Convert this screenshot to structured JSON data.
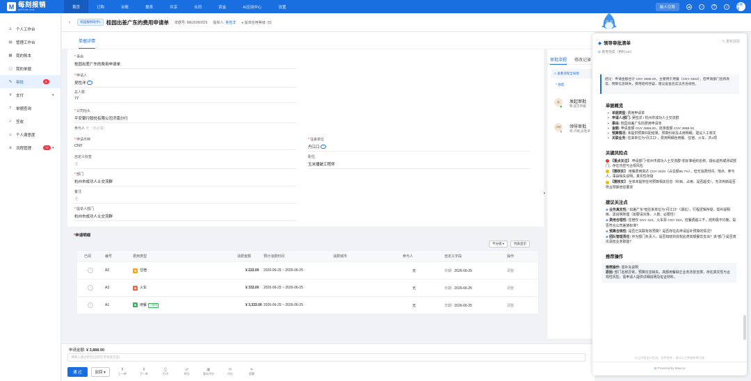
{
  "brand": {
    "logo_text": "每刻报销",
    "logo_sub": "MAYCUR.COM",
    "logo_glyph": "M"
  },
  "topnav": [
    "首页",
    "订购",
    "台账",
    "报表",
    "共享",
    "合同",
    "资金",
    "AI应用中心",
    "设置"
  ],
  "topbar": {
    "guide": "新人引导",
    "avatar_text": "吴熙洋",
    "icons": [
      "cloud-icon",
      "download-icon",
      "question-icon",
      "bell-icon"
    ]
  },
  "sidebar": [
    {
      "label": "个人工作台",
      "icon": "person-icon"
    },
    {
      "label": "管理工作台",
      "icon": "dashboard-icon"
    },
    {
      "label": "我的账本",
      "icon": "ledger-icon"
    },
    {
      "label": "我的单据",
      "icon": "document-icon"
    },
    {
      "label": "审批",
      "icon": "pen-icon",
      "badge": "2",
      "active": true
    },
    {
      "label": "支付",
      "icon": "pay-icon",
      "arrow": "▾"
    },
    {
      "label": "单据查询",
      "icon": "search-icon"
    },
    {
      "label": "签收",
      "icon": "sign-icon"
    },
    {
      "label": "个人满意度",
      "icon": "smile-icon"
    },
    {
      "label": "流程管理",
      "icon": "flow-icon",
      "badge": "77",
      "arrow": "▾"
    }
  ],
  "header": {
    "tag": "校园报财助手1",
    "title": "桂园出差广东的费用申请单",
    "doc_no_label": "单据号:",
    "doc_no": "MK26060025",
    "submitter_label": "提单人:",
    "submitter": "吴性洋",
    "credit_label": "提单信用等级:",
    "credit": "(0)"
  },
  "tab": "单据详情",
  "form": {
    "subject": {
      "label": "事由",
      "value": "桂园出差广东的费用申请单"
    },
    "applicant": {
      "label": "申请人",
      "value": "吴性洋"
    },
    "people": {
      "label": "总人数",
      "value": "77"
    },
    "company": {
      "label": "公司抬头",
      "value": "平安银行股份有限公司济南分行"
    },
    "participants": {
      "label": "参与人",
      "value": "无（非必填）"
    },
    "currency": {
      "label": "申请币种",
      "value": "CNY"
    },
    "partner": {
      "label": "往来单位",
      "value": "丹江口"
    },
    "custom_tag": {
      "label": "自定义标签",
      "value": "无"
    },
    "position": {
      "label": "职位",
      "value": "玉米播破工程师"
    },
    "dept": {
      "label": "部门",
      "value": "杭州市成功人士交流群"
    },
    "remark": {
      "label": "备注",
      "value": "无"
    },
    "owner_dept": {
      "label": "提单人部门",
      "value": "杭州市成功人士交流群"
    }
  },
  "detail": {
    "title": "申请明细",
    "filter": "不分组",
    "setting": "列表显示",
    "columns": [
      "已阅",
      "编号",
      "费用类型",
      "消费金额",
      "预计消费时间",
      "消费城市",
      "参与人",
      "自定义字段",
      "操作"
    ],
    "rows": [
      {
        "no": "A2",
        "type": "住宿",
        "type_color": "#f6a623",
        "amount": "¥ 222.00",
        "time": "2026-06-25 ~ 2026-06-25",
        "city": "",
        "people": "无",
        "custom_label": "日期:",
        "custom": "2026-06-25",
        "op": "调整"
      },
      {
        "no": "A3",
        "type": "火车",
        "type_color": "#f06a3a",
        "amount": "¥ 333.00",
        "time": "2026-06-25 ~ 2026-06-25",
        "city": "",
        "people": "无",
        "custom_label": "日期:",
        "custom": "2026-06-25",
        "op": "调整"
      },
      {
        "no": "A1",
        "type": "用餐",
        "tag": "已推荐",
        "type_color": "#35b55b",
        "amount": "¥ 3,333.00",
        "time": "2026-06-25 ~ 2026-06-25",
        "city": "",
        "people": "无",
        "custom_label": "日期:",
        "custom": "2026-06-25",
        "op": "调整"
      }
    ]
  },
  "footer": {
    "amount_label": "申请金额:",
    "amount": "¥ 3,888.00",
    "comment_placeholder": "请输入通过原因(出现在审批意见里)",
    "approve": "通 过",
    "reject": "驳回",
    "actions": [
      {
        "label": "上一单",
        "icon": "up-icon"
      },
      {
        "label": "下一单",
        "icon": "down-icon"
      },
      {
        "label": "打印",
        "icon": "print-icon"
      },
      {
        "label": "转交",
        "icon": "transfer-icon"
      },
      {
        "label": "暂存评办",
        "icon": "save-icon"
      },
      {
        "label": "评论",
        "icon": "comment-icon"
      },
      {
        "label": "提醒",
        "icon": "remind-icon"
      }
    ]
  },
  "flow": {
    "tabs": [
      "审批流程",
      "修改记录"
    ],
    "view_btn": "查看流程全局图",
    "fold": "收起",
    "nodes": [
      {
        "title": "发起审批",
        "sub": "我 提交单据",
        "avatar": "吴"
      },
      {
        "title": "领导审批",
        "sub": "待 卢婷,吴性洋",
        "avatar": "卢婷"
      }
    ]
  },
  "ai": {
    "title": "领导审批清单",
    "think": "思考完成（用时14s）",
    "refresh": "重新获取",
    "conclusion": "结论：申请金额合计 CNY 3888.00，主要用于用餐（CNY 3333），但申请部门名称异常，预算信息缺失，费用结构存疑，建议复查后实法务合规性。",
    "s1": "单据概览",
    "overview": [
      {
        "k": "单据类型:",
        "v": "费用申请单"
      },
      {
        "k": "申请人/部门:",
        "v": "吴性洋 / 杭州市成功人士交流群"
      },
      {
        "k": "事由:",
        "v": "桂园出差广东的费用申请单"
      },
      {
        "k": "金额:",
        "v": "申请金额 CNY 3888.00，批准金额 CNY 3888.00"
      },
      {
        "k": "预算情况:",
        "v": "未提供预算匹配结果，预算科目及占用明细，建议人工核实"
      },
      {
        "k": "关联业务:",
        "v": "往来单位为\"丹江口\"，费用明细含用餐、住宿、火车，共3项"
      }
    ],
    "s2": "关键风险点",
    "risks": [
      {
        "lvl": "red",
        "k": "【重点关注】",
        "v": "申请部门\"杭州市成功人士交流群\"非标准组织名称，疑似虚构或测试部门，存在内控与合规风险"
      },
      {
        "lvl": "yel",
        "k": "【需核实】",
        "v": "用餐费用高达 CNY 3333（占总额85.7%），但无消费时间、地点、参与人，事由缺失说明，真实性存疑"
      },
      {
        "lvl": "yel",
        "k": "【需核实】",
        "v": "全单未提供任何预算相关信息（科目、占用、是否超支），无法判断是否符合预算管控要求"
      }
    ],
    "s3": "建议关注点",
    "suggestions": [
      {
        "k": "业务真实性:",
        "v": "\"出差广东\"但往来单位为\"丹江口\"（湖北），行程逻辑存疑，需补提明晰、需说明地理（如要请对象、人数、必要性）"
      },
      {
        "k": "费用合理性:",
        "v": "住宿仅 CNY 222、火车票 CNY 333，但餐费超三千，结构极不均衡，是否符合公司差旅标准？"
      },
      {
        "k": "预算合规性:",
        "v": "是否已关联有效预算？是否存在先申请后补预算的情况？"
      },
      {
        "k": "团队管理责任:",
        "v": "作为部门负责人，是否知晓并授权此类高额餐饮支出？该\"部门\"是否真实承担业务职能？"
      }
    ],
    "s4": "推荐操作",
    "rec_k": "推荐操作:",
    "rec_v": "需补充说明",
    "reason_k": "原因:",
    "reason_v": "部门名称异常，预算信息缺失，高额用餐缺乏业务背景支撑，存在真实性与合规性风险，需申请人提供详细说明及佐证材料。",
    "footnote": "以上内容由AI生成，仅供参考，请以人工审核结果为准",
    "powered": "Powered by Maycur"
  }
}
